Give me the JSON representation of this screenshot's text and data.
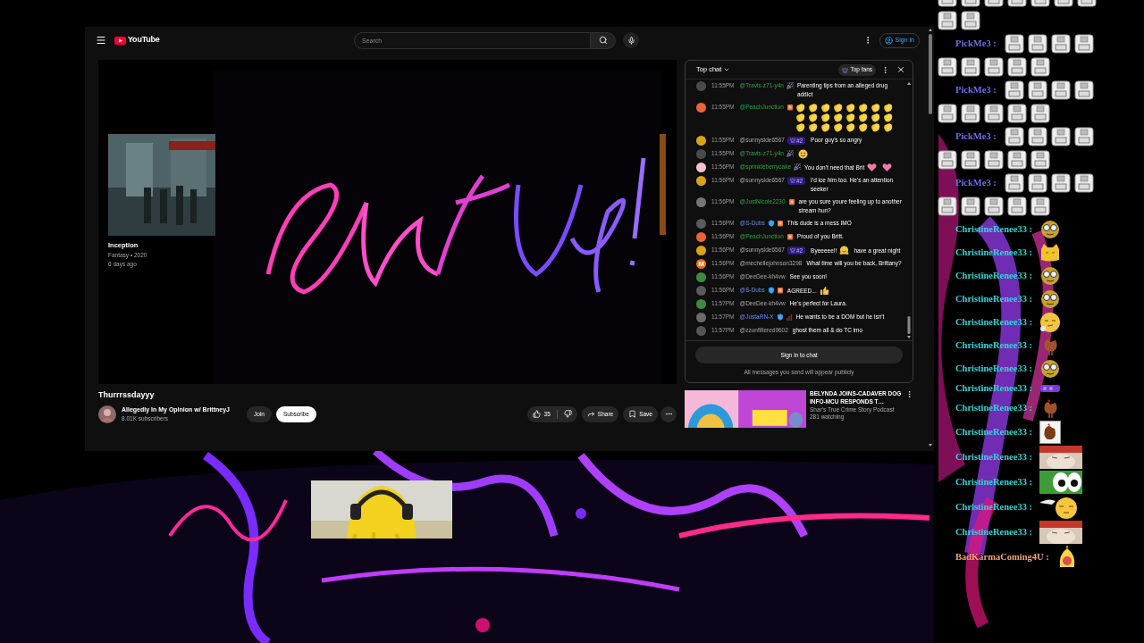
{
  "top_bar": {
    "logo": "YouTube",
    "search": {
      "placeholder": "Search"
    },
    "sign_in": "Sign in"
  },
  "player": {
    "card": {
      "title": "Inception",
      "meta": "Fantasy • 2020",
      "age": "6 days ago"
    }
  },
  "video": {
    "title": "Thurrrssdayyy",
    "channel": "Allegedly In My Opinion w/ BrittneyJ",
    "subscribers": "8.01K subscribers",
    "join": "Join",
    "subscribe": "Subscribe",
    "likes": "35",
    "share": "Share",
    "save": "Save"
  },
  "chat": {
    "title": "Top chat",
    "top_fans": "Top fans",
    "messages": [
      {
        "time": "11:55PM",
        "author": "@Travis-z71-y4n",
        "kind": "member",
        "avatar": {
          "color": "#4a4a4a"
        },
        "badges": [
          {
            "kind": "gift"
          }
        ],
        "parts": [
          {
            "kind": "text",
            "text": "Parenting tips from an alleged drug addict"
          }
        ]
      },
      {
        "time": "11:55PM",
        "author": "@PeachJunction",
        "kind": "member",
        "avatar": {
          "color": "#e8643a"
        },
        "badges": [
          {
            "kind": "cup"
          }
        ],
        "parts": [
          {
            "kind": "clap"
          },
          {
            "kind": "clap"
          },
          {
            "kind": "clap"
          },
          {
            "kind": "clap"
          },
          {
            "kind": "clap"
          },
          {
            "kind": "clap"
          },
          {
            "kind": "clap"
          },
          {
            "kind": "clap"
          },
          {
            "kind": "clap"
          },
          {
            "kind": "clap"
          },
          {
            "kind": "clap"
          },
          {
            "kind": "clap"
          },
          {
            "kind": "clap"
          },
          {
            "kind": "clap"
          },
          {
            "kind": "clap"
          },
          {
            "kind": "clap"
          },
          {
            "kind": "clap"
          },
          {
            "kind": "clap"
          },
          {
            "kind": "clap"
          },
          {
            "kind": "clap"
          },
          {
            "kind": "clap"
          },
          {
            "kind": "clap"
          },
          {
            "kind": "clap"
          },
          {
            "kind": "clap"
          }
        ]
      },
      {
        "time": "11:55PM",
        "author": "@sunnyside6567",
        "kind": "viewer",
        "avatar": {
          "color": "#d9a21b"
        },
        "rank": "#2",
        "parts": [
          {
            "kind": "text",
            "text": "Poor guy's so angry"
          }
        ]
      },
      {
        "time": "11:55PM",
        "author": "@Travis-z71-y4n",
        "kind": "member",
        "avatar": {
          "color": "#4a4a4a"
        },
        "badges": [
          {
            "kind": "gift"
          }
        ],
        "parts": [
          {
            "kind": "smile"
          }
        ]
      },
      {
        "time": "11:56PM",
        "author": "@sprinkleberrycake",
        "kind": "member",
        "avatar": {
          "color": "#f1c3cf"
        },
        "badges": [
          {
            "kind": "gift"
          }
        ],
        "parts": [
          {
            "kind": "text",
            "text": "You don't need that Brit"
          },
          {
            "kind": "heart"
          },
          {
            "kind": "heart"
          }
        ]
      },
      {
        "time": "11:56PM",
        "author": "@sunnyside6567",
        "kind": "viewer",
        "avatar": {
          "color": "#d9a21b"
        },
        "rank": "#2",
        "parts": [
          {
            "kind": "text",
            "text": "I'd ice him too. He's an attention seeker"
          }
        ]
      },
      {
        "time": "11:56PM",
        "author": "@JustNicole2230",
        "kind": "member",
        "avatar": {
          "color": "#777777"
        },
        "badges": [
          {
            "kind": "cup"
          }
        ],
        "parts": [
          {
            "kind": "text",
            "text": "are you sure youre feeling up to another stream hun?"
          }
        ]
      },
      {
        "time": "11:56PM",
        "author": "@S-Dubs",
        "kind": "moderator",
        "avatar": {
          "color": "#5a5a5a"
        },
        "badges": [
          {
            "kind": "shield"
          },
          {
            "kind": "cup"
          }
        ],
        "parts": [
          {
            "kind": "text",
            "text": "This dude is a mess IMO"
          }
        ]
      },
      {
        "time": "11:56PM",
        "author": "@PeachJunction",
        "kind": "member",
        "avatar": {
          "color": "#e8643a"
        },
        "badges": [
          {
            "kind": "cup"
          }
        ],
        "parts": [
          {
            "kind": "text",
            "text": "Proud of you Britt."
          }
        ]
      },
      {
        "time": "11:56PM",
        "author": "@sunnyside6567",
        "kind": "viewer",
        "avatar": {
          "color": "#d9a21b"
        },
        "rank": "#2",
        "parts": [
          {
            "kind": "text",
            "text": "Byeeeee!!"
          },
          {
            "kind": "hug"
          },
          {
            "kind": "text",
            "text": "have a great night"
          }
        ]
      },
      {
        "time": "11:56PM",
        "author": "@mechellejohnson3298",
        "kind": "viewer",
        "avatar": {
          "color": "#e8711a",
          "letter": "M"
        },
        "parts": [
          {
            "kind": "text",
            "text": "What time will you be back, Brittany?"
          }
        ]
      },
      {
        "time": "11:56PM",
        "author": "@DeeDee-kh4vw",
        "kind": "viewer",
        "avatar": {
          "color": "#3f8a3f"
        },
        "parts": [
          {
            "kind": "text",
            "text": "See you soon!"
          }
        ]
      },
      {
        "time": "11:56PM",
        "author": "@S-Dubs",
        "kind": "moderator",
        "avatar": {
          "color": "#5a5a5a"
        },
        "badges": [
          {
            "kind": "shield"
          },
          {
            "kind": "cup"
          }
        ],
        "parts": [
          {
            "kind": "text",
            "text": "AGREED..."
          },
          {
            "kind": "thumbs"
          }
        ]
      },
      {
        "time": "11:57PM",
        "author": "@DeeDee-kh4vw",
        "kind": "viewer",
        "avatar": {
          "color": "#3f8a3f"
        },
        "parts": [
          {
            "kind": "text",
            "text": "He's perfect for Laura."
          }
        ]
      },
      {
        "time": "11:57PM",
        "author": "@JustaRN-X",
        "kind": "moderator",
        "avatar": {
          "color": "#6a6a6a"
        },
        "badges": [
          {
            "kind": "shield"
          },
          {
            "kind": "bars"
          }
        ],
        "parts": [
          {
            "kind": "text",
            "text": "He wants to be a DOM but he isn't"
          }
        ]
      },
      {
        "time": "11:57PM",
        "author": "@zzunfiltered9602",
        "kind": "viewer",
        "avatar": {
          "color": "#555555"
        },
        "parts": [
          {
            "kind": "text",
            "text": "ghost them all & do TC imo"
          }
        ]
      }
    ],
    "sign_in": "Sign in to chat",
    "notice": "All messages you send will appear publicly"
  },
  "recommended": [
    {
      "title": "BELYNDA JOINS-CADAVER DOG INFO-MCU RESPONDS T…",
      "channel": "Shar's True Crime Story Podcast",
      "viewers": "281 watching"
    }
  ],
  "overlay_chat": [
    {
      "emotes": [
        {
          "kind": "cube"
        },
        {
          "kind": "cube"
        },
        {
          "kind": "cube"
        },
        {
          "kind": "cube"
        },
        {
          "kind": "cube"
        },
        {
          "kind": "cube"
        },
        {
          "kind": "cube"
        },
        {
          "kind": "cube"
        },
        {
          "kind": "cube"
        }
      ]
    },
    {
      "user": "PickMe3 :",
      "color": "#6f6fe8",
      "emotes": [
        {
          "kind": "cube"
        },
        {
          "kind": "cube"
        },
        {
          "kind": "cube"
        },
        {
          "kind": "cube"
        },
        {
          "kind": "cube"
        },
        {
          "kind": "cube"
        },
        {
          "kind": "cube"
        },
        {
          "kind": "cube"
        },
        {
          "kind": "cube"
        }
      ]
    },
    {
      "user": "PickMe3 :",
      "color": "#6f6fe8",
      "emotes": [
        {
          "kind": "cube"
        },
        {
          "kind": "cube"
        },
        {
          "kind": "cube"
        },
        {
          "kind": "cube"
        },
        {
          "kind": "cube"
        },
        {
          "kind": "cube"
        },
        {
          "kind": "cube"
        },
        {
          "kind": "cube"
        },
        {
          "kind": "cube"
        }
      ]
    },
    {
      "user": "PickMe3 :",
      "color": "#6f6fe8",
      "emotes": [
        {
          "kind": "cube"
        },
        {
          "kind": "cube"
        },
        {
          "kind": "cube"
        },
        {
          "kind": "cube"
        },
        {
          "kind": "cube"
        },
        {
          "kind": "cube"
        },
        {
          "kind": "cube"
        },
        {
          "kind": "cube"
        },
        {
          "kind": "cube"
        }
      ]
    },
    {
      "user": "PickMe3 :",
      "color": "#6f6fe8",
      "emotes": [
        {
          "kind": "cube"
        },
        {
          "kind": "cube"
        },
        {
          "kind": "cube"
        },
        {
          "kind": "cube"
        },
        {
          "kind": "cube"
        },
        {
          "kind": "cube"
        },
        {
          "kind": "cube"
        },
        {
          "kind": "cube"
        },
        {
          "kind": "cube"
        }
      ]
    },
    {
      "user": "ChristineRenee33 :",
      "color": "#33d6d6",
      "emotes": [
        {
          "kind": "nerd"
        }
      ]
    },
    {
      "user": "ChristineRenee33 :",
      "color": "#33d6d6",
      "emotes": [
        {
          "kind": "cat"
        }
      ]
    },
    {
      "user": "ChristineRenee33 :",
      "color": "#33d6d6",
      "emotes": [
        {
          "kind": "nerd"
        }
      ]
    },
    {
      "user": "ChristineRenee33 :",
      "color": "#33d6d6",
      "emotes": [
        {
          "kind": "nerd"
        }
      ]
    },
    {
      "user": "ChristineRenee33 :",
      "color": "#33d6d6",
      "emotes": [
        {
          "kind": "smirk"
        }
      ]
    },
    {
      "user": "ChristineRenee33 :",
      "color": "#33d6d6",
      "emotes": [
        {
          "kind": "rooster"
        }
      ]
    },
    {
      "user": "ChristineRenee33 :",
      "color": "#33d6d6",
      "emotes": [
        {
          "kind": "nerd"
        }
      ]
    },
    {
      "user": "ChristineRenee33 :",
      "color": "#33d6d6",
      "emotes": [
        {
          "kind": "sticker"
        }
      ]
    },
    {
      "user": "ChristineRenee33 :",
      "color": "#33d6d6",
      "emotes": [
        {
          "kind": "rooster"
        }
      ]
    },
    {
      "user": "ChristineRenee33 :",
      "color": "#33d6d6",
      "emotes": [
        {
          "kind": "rooster-card"
        }
      ]
    },
    {
      "user": "ChristineRenee33 :",
      "color": "#33d6d6",
      "emotes": [
        {
          "kind": "cat-photo"
        }
      ]
    },
    {
      "user": "ChristineRenee33 :",
      "color": "#33d6d6",
      "emotes": [
        {
          "kind": "frog"
        }
      ]
    },
    {
      "user": "ChristineRenee33 :",
      "color": "#33d6d6",
      "emotes": [
        {
          "kind": "sleepy"
        }
      ]
    },
    {
      "user": "ChristineRenee33 :",
      "color": "#33d6d6",
      "emotes": [
        {
          "kind": "cat-photo"
        }
      ]
    },
    {
      "user": "BadKarmaComing4U :",
      "color": "#e8a77a",
      "emotes": [
        {
          "kind": "chick"
        }
      ]
    }
  ]
}
